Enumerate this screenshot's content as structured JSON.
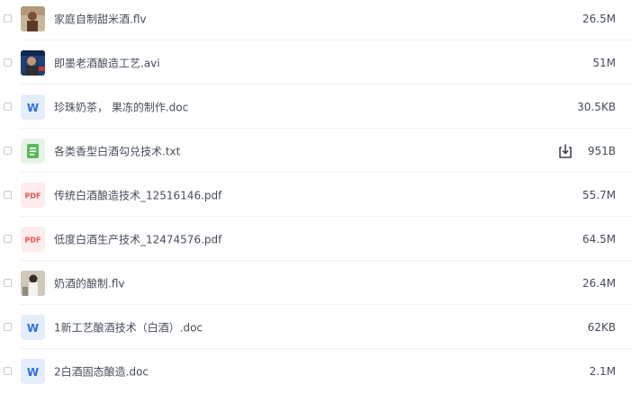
{
  "files": [
    {
      "name": "家庭自制甜米酒.flv",
      "size": "26.5M",
      "type": "video",
      "icon": "video-thumbnail-icon"
    },
    {
      "name": "即墨老酒酿造工艺.avi",
      "size": "51M",
      "type": "video",
      "icon": "video-thumbnail-icon"
    },
    {
      "name": "珍珠奶茶， 果冻的制作.doc",
      "size": "30.5KB",
      "type": "doc",
      "icon": "word-doc-icon"
    },
    {
      "name": "各类香型白酒勾兑技术.txt",
      "size": "951B",
      "type": "txt",
      "icon": "txt-file-icon"
    },
    {
      "name": "传统白酒酿造技术_12516146.pdf",
      "size": "55.7M",
      "type": "pdf",
      "icon": "pdf-file-icon"
    },
    {
      "name": "低度白酒生产技术_12474576.pdf",
      "size": "64.5M",
      "type": "pdf",
      "icon": "pdf-file-icon"
    },
    {
      "name": "奶酒的酿制.flv",
      "size": "26.4M",
      "type": "video",
      "icon": "video-thumbnail-icon"
    },
    {
      "name": "1新工艺酿酒技术（白酒）.doc",
      "size": "62KB",
      "type": "doc",
      "icon": "word-doc-icon"
    },
    {
      "name": "2白酒固态酿造.doc",
      "size": "2.1M",
      "type": "doc",
      "icon": "word-doc-icon"
    }
  ],
  "download_icon": "download-icon",
  "colors": {
    "word": "#2f6fe0",
    "word_bg": "#e3edfc",
    "txt": "#5cb85c",
    "pdf": "#e6534f",
    "pdf_bg": "#fdeceb"
  }
}
